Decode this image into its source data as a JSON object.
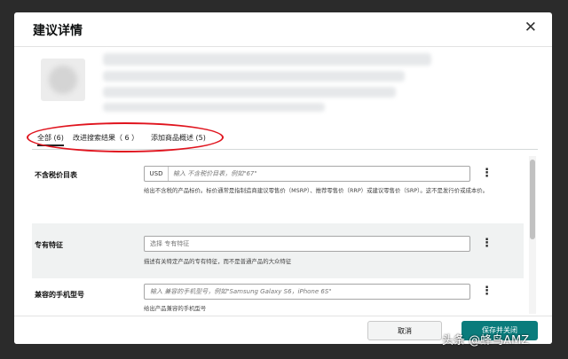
{
  "dialog": {
    "title": "建议详情",
    "close_icon": "close-icon"
  },
  "tabs": [
    {
      "label": "全部 (6)",
      "active": true
    },
    {
      "label": "改进搜索结果（ 6 ）",
      "active": false
    },
    {
      "label": "添加商品概述 (5)",
      "active": false
    }
  ],
  "fields": [
    {
      "label": "不含税价目表",
      "prefix": "USD",
      "placeholder": "输入 不含税价目表，例如\"67\"",
      "help": "给出不含税的产品标价。标价通常是指制造商建议零售价（MSRP）、推荐零售价（RRP）或建议零售价（SRP）。这不是发行价或成本价。"
    },
    {
      "label": "专有特征",
      "placeholder": "选择 专有特征",
      "help": "描述有关特定产品的专有特征，而不是普通产品的大众特征"
    },
    {
      "label": "兼容的手机型号",
      "placeholder": "输入 兼容的手机型号，例如\"Samsung Galaxy S6，iPhone 6S\"",
      "help": "给出产品兼容的手机型号"
    }
  ],
  "footer": {
    "cancel_label": "取消",
    "save_label": "保存并关闭"
  },
  "watermark": "头条 @蜂鸟AMZ",
  "colors": {
    "accent": "#0a7c7c",
    "highlight_circle": "#e0141e"
  }
}
